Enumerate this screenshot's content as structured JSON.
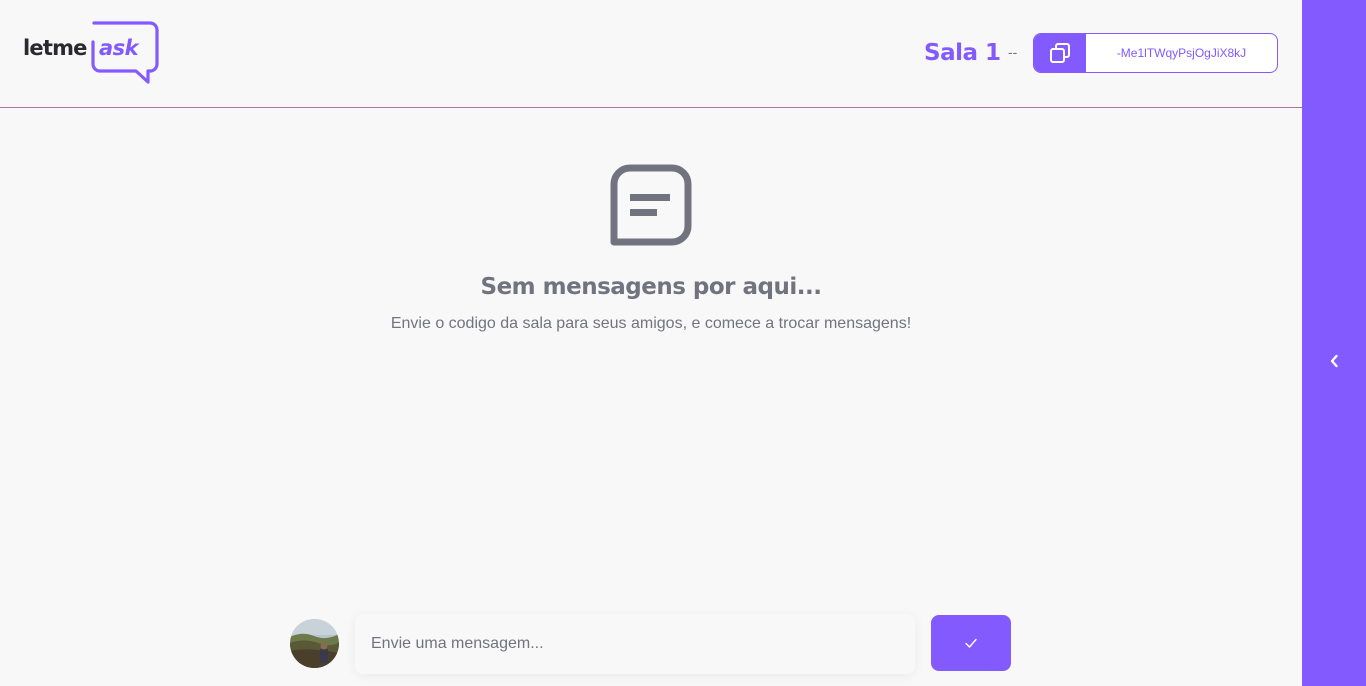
{
  "header": {
    "logo": {
      "text_plain": "letme",
      "text_accent": "ask"
    },
    "room_title": "Sala 1",
    "room_separator": "--",
    "room_code": "-Me1lTWqyPsjOgJiX8kJ"
  },
  "empty_state": {
    "icon": "message-icon",
    "title": "Sem mensagens por aqui...",
    "subtitle": "Envie o codigo da sala para seus amigos, e comece a trocar mensagens!"
  },
  "composer": {
    "placeholder": "Envie uma mensagem...",
    "value": "",
    "send_icon": "check-icon"
  },
  "sidebar": {
    "toggle_icon": "chevron-left-icon"
  },
  "colors": {
    "accent": "#835afd",
    "text_muted": "#737380",
    "background": "#f8f8f8"
  }
}
